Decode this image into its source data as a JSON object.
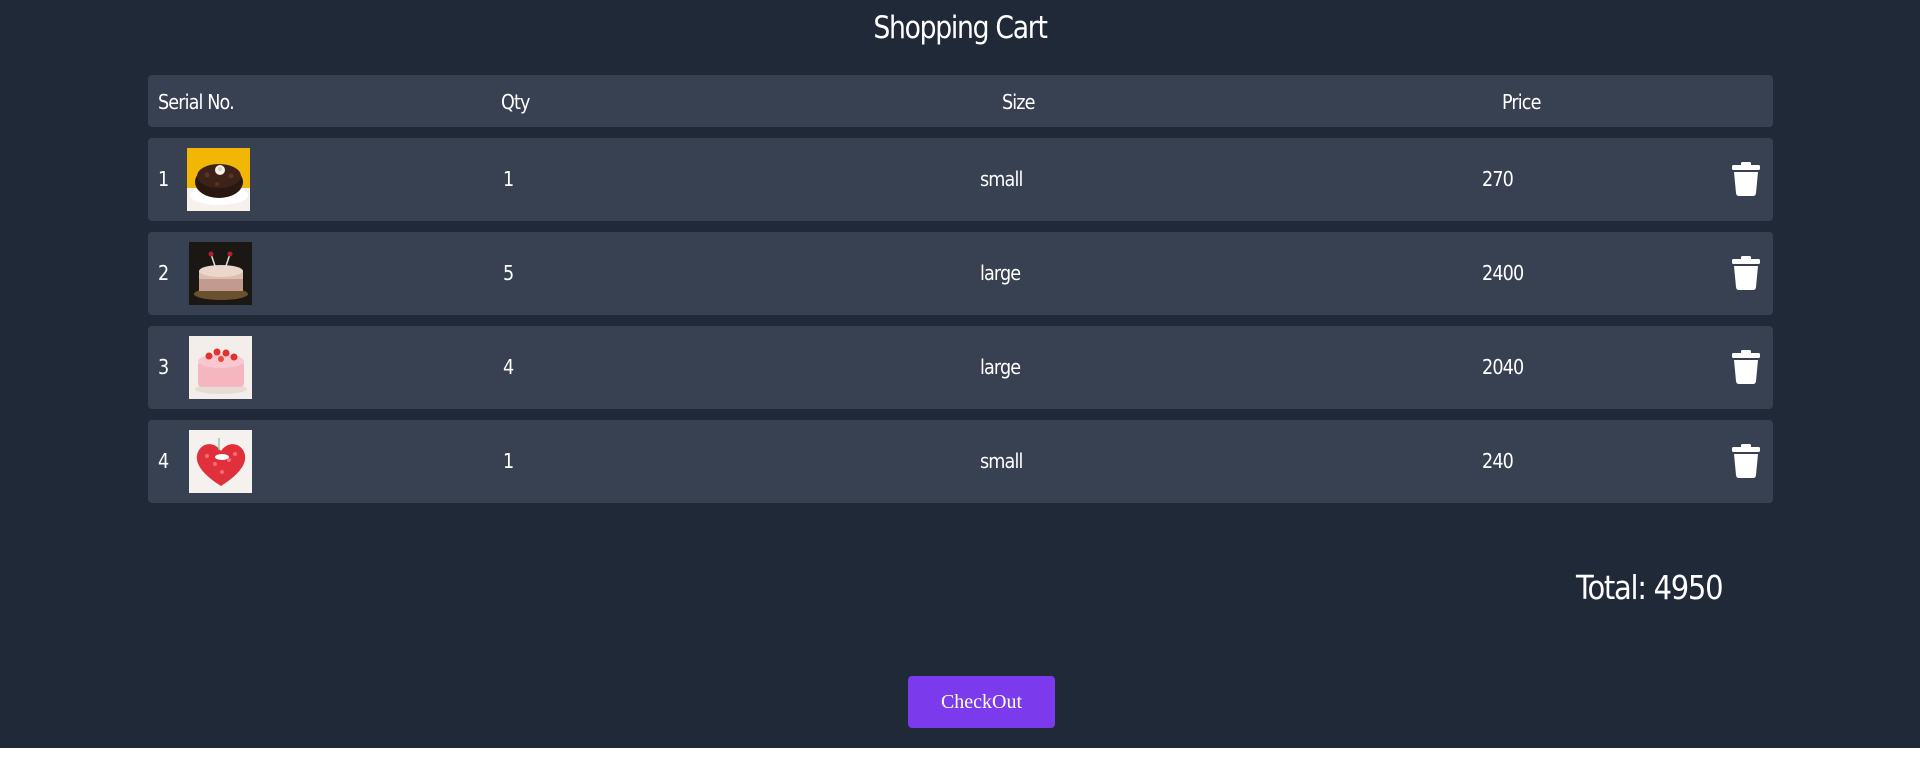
{
  "page": {
    "title": "Shopping Cart"
  },
  "table": {
    "headers": {
      "serial": "Serial No.",
      "qty": "Qty",
      "size": "Size",
      "price": "Price"
    },
    "rows": [
      {
        "serial": "1",
        "qty": "1",
        "size": "small",
        "price": "270",
        "image": "chocolate-cake-image"
      },
      {
        "serial": "2",
        "qty": "5",
        "size": "large",
        "price": "2400",
        "image": "cream-cake-image"
      },
      {
        "serial": "3",
        "qty": "4",
        "size": "large",
        "price": "2040",
        "image": "strawberry-cake-image"
      },
      {
        "serial": "4",
        "qty": "1",
        "size": "small",
        "price": "240",
        "image": "red-heart-cake-image"
      }
    ],
    "delete_icon": "trash-icon"
  },
  "summary": {
    "total_label": "Total: 4950"
  },
  "actions": {
    "checkout_label": "CheckOut"
  },
  "colors": {
    "background": "#1f2937",
    "row": "#374151",
    "accent": "#7c3aed",
    "text": "#ffffff"
  }
}
